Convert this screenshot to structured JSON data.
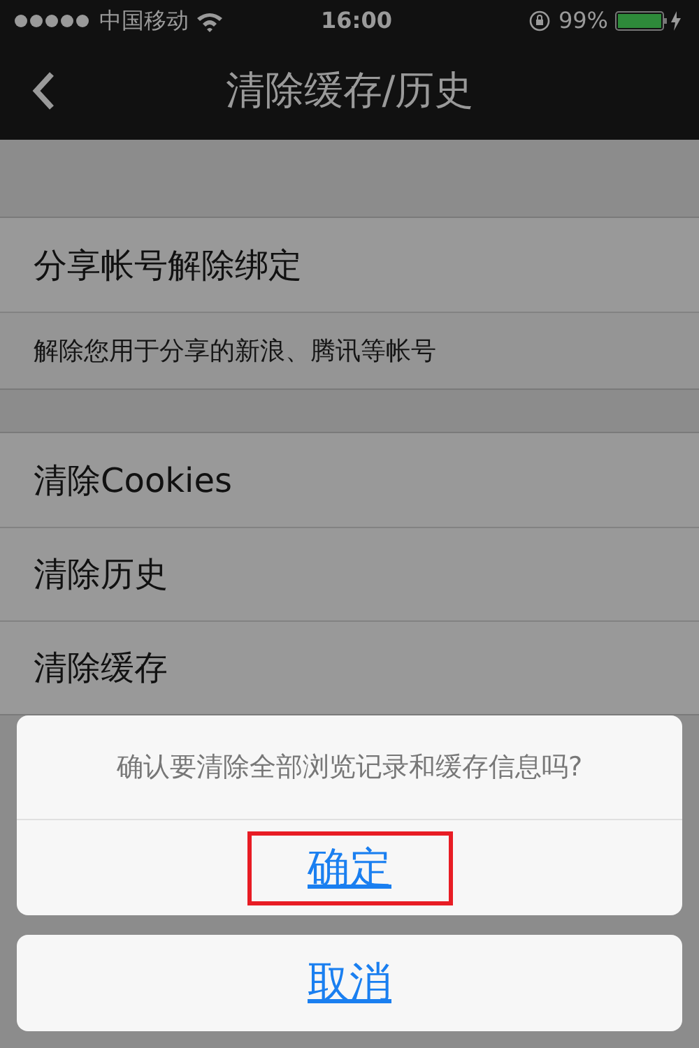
{
  "status_bar": {
    "carrier": "中国移动",
    "time": "16:00",
    "battery": "99%"
  },
  "nav_bar": {
    "title": "清除缓存/历史"
  },
  "sections": [
    {
      "items": [
        {
          "kind": "title",
          "text": "分享帐号解除绑定"
        },
        {
          "kind": "note",
          "text": "解除您用于分享的新浪、腾讯等帐号"
        }
      ]
    },
    {
      "items": [
        {
          "kind": "title",
          "text": "清除Cookies"
        },
        {
          "kind": "title",
          "text": "清除历史"
        },
        {
          "kind": "title",
          "text": "清除缓存"
        }
      ]
    }
  ],
  "action_sheet": {
    "message": "确认要清除全部浏览记录和缓存信息吗?",
    "confirm": {
      "label": "确定",
      "highlighted": true
    },
    "cancel": {
      "label": "取消"
    }
  }
}
